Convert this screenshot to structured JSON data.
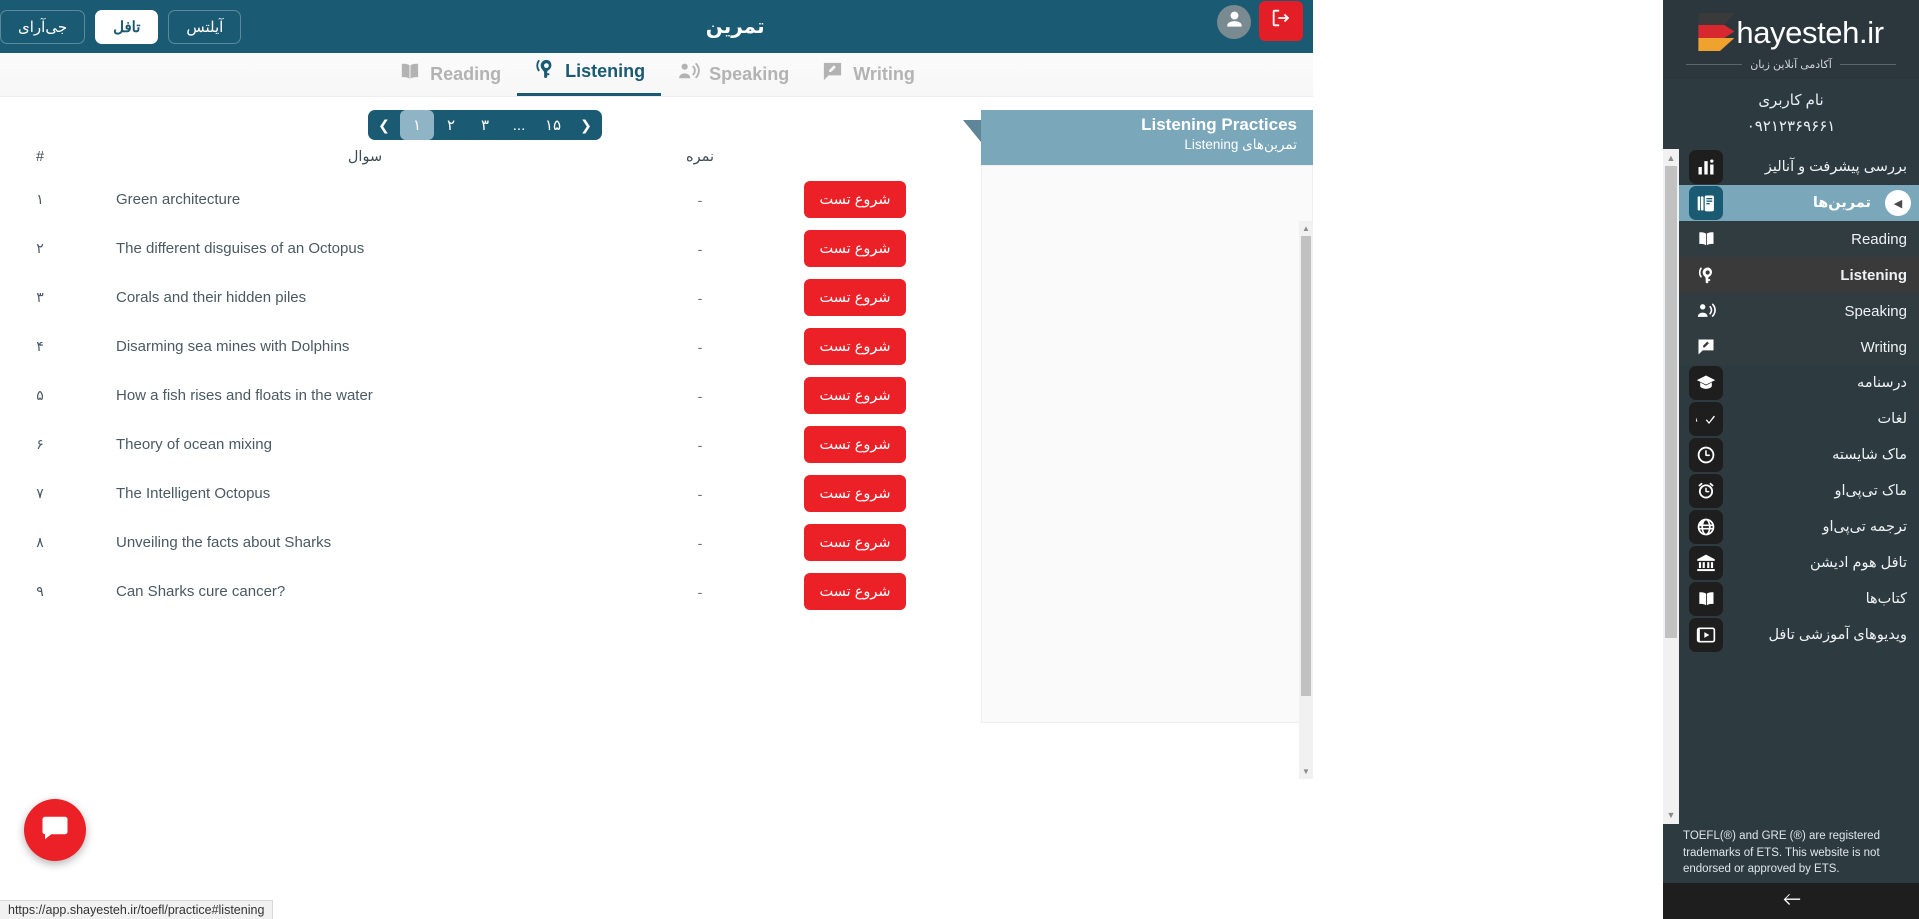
{
  "topbar": {
    "title": "تمرین",
    "exit_icon": "logout-icon",
    "avatar_icon": "user-avatar-icon",
    "pills": [
      {
        "label": "جی‌آرای",
        "active": false
      },
      {
        "label": "تافل",
        "active": true
      },
      {
        "label": "آیلتس",
        "active": false
      }
    ]
  },
  "tabs": [
    {
      "label": "Writing",
      "icon": "writing-icon",
      "active": false
    },
    {
      "label": "Speaking",
      "icon": "speaking-icon",
      "active": false
    },
    {
      "label": "Listening",
      "icon": "listening-icon",
      "active": true
    },
    {
      "label": "Reading",
      "icon": "reading-icon",
      "active": false
    }
  ],
  "pagination": {
    "prev_icon": "chevron-left-icon",
    "next_icon": "chevron-right-icon",
    "pages": [
      "۱",
      "۲",
      "۳",
      "...",
      "۱۵"
    ],
    "current": "۱"
  },
  "panel": {
    "title": "Listening Practices",
    "subtitle": "تمرین‌های Listening"
  },
  "table": {
    "headers": {
      "score": "نمره",
      "question": "سوال",
      "hash": "#",
      "action": ""
    },
    "rows": [
      {
        "num": "۱",
        "title": "Green architecture",
        "score": "-",
        "button": "شروع تست"
      },
      {
        "num": "۲",
        "title": "The different disguises of an Octopus",
        "score": "-",
        "button": "شروع تست"
      },
      {
        "num": "۳",
        "title": "Corals and their hidden piles",
        "score": "-",
        "button": "شروع تست"
      },
      {
        "num": "۴",
        "title": "Disarming sea mines with Dolphins",
        "score": "-",
        "button": "شروع تست"
      },
      {
        "num": "۵",
        "title": "How a fish rises and floats in the water",
        "score": "-",
        "button": "شروع تست"
      },
      {
        "num": "۶",
        "title": "Theory of ocean mixing",
        "score": "-",
        "button": "شروع تست"
      },
      {
        "num": "۷",
        "title": "The Intelligent Octopus",
        "score": "-",
        "button": "شروع تست"
      },
      {
        "num": "۸",
        "title": "Unveiling the facts about Sharks",
        "score": "-",
        "button": "شروع تست"
      },
      {
        "num": "۹",
        "title": "Can Sharks cure cancer?",
        "score": "-",
        "button": "شروع تست"
      }
    ]
  },
  "sidebar": {
    "logo_text": "hayesteh.ir",
    "logo_sub": "آکادمی آنلاین زبان",
    "user_name": "نام کاربری",
    "user_phone": "۰۹۲۱۲۳۶۹۶۶۱",
    "items": [
      {
        "label": "بررسی پیشرفت و آنالیز",
        "icon": "bar-chart-icon",
        "state": "normal"
      },
      {
        "label": "تمرین‌ها",
        "icon": "practices-icon",
        "state": "active"
      },
      {
        "label": "Reading",
        "icon": "reading-icon",
        "state": "sub"
      },
      {
        "label": "Listening",
        "icon": "listening-icon",
        "state": "sub-active"
      },
      {
        "label": "Speaking",
        "icon": "speaking-icon",
        "state": "sub"
      },
      {
        "label": "Writing",
        "icon": "writing-icon",
        "state": "sub"
      },
      {
        "label": "درسنامه",
        "icon": "graduation-cap-icon",
        "state": "normal"
      },
      {
        "label": "لغات",
        "icon": "vocabulary-icon",
        "state": "normal"
      },
      {
        "label": "ماک شایسته",
        "icon": "clock-icon",
        "state": "normal"
      },
      {
        "label": "ماک تی‌پی‌او",
        "icon": "alarm-clock-icon",
        "state": "normal"
      },
      {
        "label": "ترجمه تی‌پی‌او",
        "icon": "globe-icon",
        "state": "normal"
      },
      {
        "label": "تافل هوم ادیشن",
        "icon": "bank-icon",
        "state": "normal"
      },
      {
        "label": "کتاب‌ها",
        "icon": "book-icon",
        "state": "normal"
      },
      {
        "label": "ویدیوهای آموزشی تافل",
        "icon": "video-icon",
        "state": "normal"
      }
    ],
    "disclaimer": "TOEFL(®) and GRE (®) are registered trademarks of ETS. This website is not endorsed or approved by ETS.",
    "footer_icon": "collapse-sidebar-icon"
  },
  "chat": {
    "icon": "chat-bubble-icon"
  },
  "status_bar": {
    "url": "https://app.shayesteh.ir/toefl/practice#listening"
  },
  "colors": {
    "brand_dark": "#1b5a73",
    "brand_light": "#7ba7bb",
    "accent_red": "#ec2027",
    "sidebar_bg": "#2d3a40"
  }
}
